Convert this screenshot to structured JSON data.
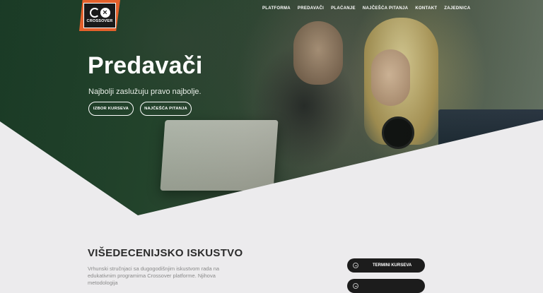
{
  "logo": {
    "text": "CROSSOVER",
    "brand_color": "#e4602b"
  },
  "nav": {
    "items": [
      "PLATFORMA",
      "PREDAVAČI",
      "PLAĆANJE",
      "NAJČEŠĆA PITANJA",
      "KONTAKT",
      "ZAJEDNICA"
    ]
  },
  "hero": {
    "title": "Predavači",
    "subtitle": "Najbolji zaslužuju pravo najbolje.",
    "buttons": {
      "kursevi": "IZBOR KURSEVA",
      "faq": "NAJČEŠĆA PITANJA"
    }
  },
  "section": {
    "title": "VIŠEDECENIJSKO ISKUSTVO",
    "text": "Vrhunski stručnjaci sa dugogodišnjim iskustvom rada na edukativnim programima Crossover platforme. Njihova metodologija"
  },
  "side_buttons": {
    "termini": "TERMINI KURSEVA",
    "second": ""
  },
  "colors": {
    "background": "#ecebed",
    "dark_button": "#1c1c1c",
    "accent": "#e4602b"
  }
}
